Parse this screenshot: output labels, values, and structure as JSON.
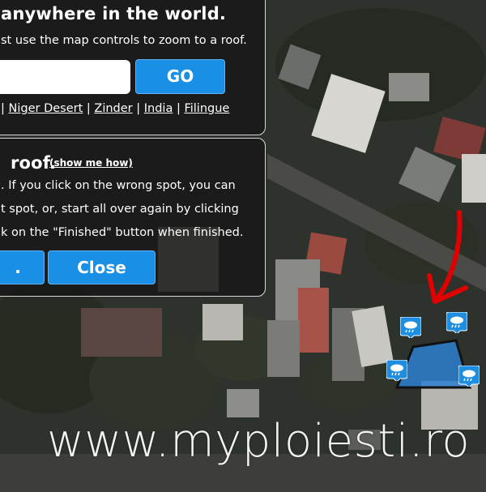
{
  "search_panel": {
    "title": "anywhere in the world.",
    "instruction": "st use the map controls to zoom to a roof.",
    "search_placeholder": "",
    "go_label": "GO",
    "links": [
      "Niger Desert",
      "Zinder",
      "India",
      "Filingue"
    ],
    "link_separator": "|"
  },
  "roof_panel": {
    "title": "roof.",
    "show_me_how": "(show me how)",
    "lines": [
      ". If you click on the wrong spot, you can",
      "t spot, or, start all over again by clicking",
      "k on the \"Finished\" button when finished."
    ],
    "left_button_label": ".",
    "close_label": "Close"
  },
  "watermark": "www.myploiesti.ro",
  "marker_icon": "cloud-rain-icon",
  "colors": {
    "button_blue": "#1a8fe6",
    "arrow_red": "#e00000",
    "marker_blue": "#1e8fe0",
    "polygon_fill": "#2d7fd0"
  }
}
